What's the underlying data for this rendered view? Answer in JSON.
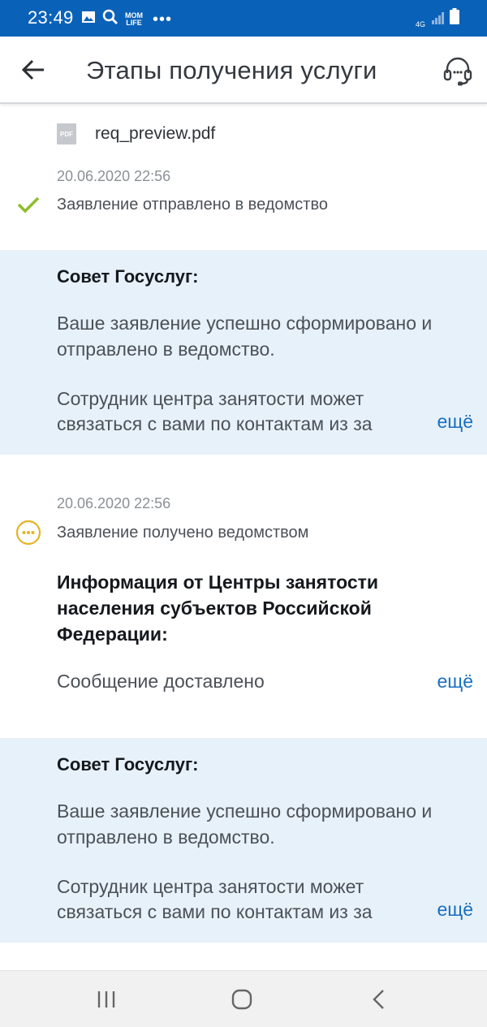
{
  "status_bar": {
    "time": "23:49",
    "app_badge": "MOM LIFE",
    "more_dots": "•••",
    "network": "4G",
    "color": "#0a62b8"
  },
  "header": {
    "title": "Этапы получения услуги",
    "back_icon": "arrow-left-icon",
    "support_icon": "headset-icon"
  },
  "file": {
    "icon_label": "PDF",
    "name": "req_preview.pdf"
  },
  "events": [
    {
      "date": "20.06.2020 22:56",
      "text": "Заявление отправлено в ведомство",
      "status_icon": "check-icon",
      "status_color": "#8cbd2c"
    },
    {
      "date": "20.06.2020 22:56",
      "text": "Заявление получено ведомством",
      "status_icon": "pending-dots-icon",
      "status_color": "#e6b325"
    }
  ],
  "advice_blocks": [
    {
      "title": "Совет Госуслуг:",
      "p1": "Ваше заявление успешно сформировано и отправлено в ведомство.",
      "p2_line1": "Сотрудник центра занятости может",
      "p2_line2": "связаться с вами по контактам из за",
      "more": "ещё"
    },
    {
      "title": "Совет Госуслуг:",
      "p1": "Ваше заявление успешно сформировано и отправлено в ведомство.",
      "p2_line1": "Сотрудник центра занятости может",
      "p2_line2": "связаться с вами по контактам из за",
      "more": "ещё"
    }
  ],
  "info": {
    "title": "Информация от Центры занятости населения субъектов Российской Федерации:",
    "text": "Сообщение доставлено",
    "more": "ещё"
  },
  "colors": {
    "accent": "#1a6fbf",
    "advice_bg": "#e7f1fa"
  },
  "nav_bar": {
    "recent_icon": "recent-apps-icon",
    "home_icon": "home-icon",
    "back_icon": "nav-back-icon"
  }
}
